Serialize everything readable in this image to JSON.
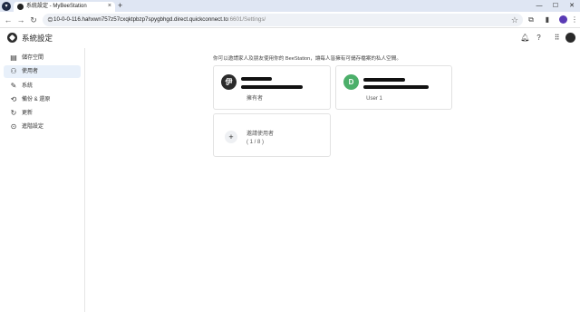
{
  "browser": {
    "tab_title": "系統設定 - MyBeeStation",
    "url_host": "10-0-0-116.hahxwn757z57cxqktpbzp7spygbhgd.direct.quickconnect.to",
    "url_path": ":6601/Settings/",
    "new_tab_label": "+",
    "tab_close_label": "×"
  },
  "app": {
    "title": "系統設定"
  },
  "sidebar": {
    "items": [
      {
        "label": "儲存空間",
        "icon": "storage-icon",
        "glyph": "▤"
      },
      {
        "label": "使用者",
        "icon": "user-icon",
        "glyph": "◯"
      },
      {
        "label": "系統",
        "icon": "wrench-icon",
        "glyph": "✎"
      },
      {
        "label": "備份 & 還原",
        "icon": "backup-icon",
        "glyph": "⟲"
      },
      {
        "label": "更新",
        "icon": "update-icon",
        "glyph": "↻"
      },
      {
        "label": "進階設定",
        "icon": "advanced-settings-icon",
        "glyph": "⊙"
      }
    ],
    "active_index": 1
  },
  "main": {
    "intro": "你可以邀請家人及朋友使用你的 BeeStation，讓每人皆擁有可儲存檔案的私人空間。",
    "users": [
      {
        "avatar_letter": "伊",
        "role": "擁有者",
        "avatar_color": "#2b2b2b"
      },
      {
        "avatar_letter": "D",
        "role": "User 1",
        "avatar_color": "#4caf6a"
      }
    ],
    "invite": {
      "plus": "+",
      "title": "邀請使用者",
      "count": "( 1 / 8 )"
    }
  }
}
